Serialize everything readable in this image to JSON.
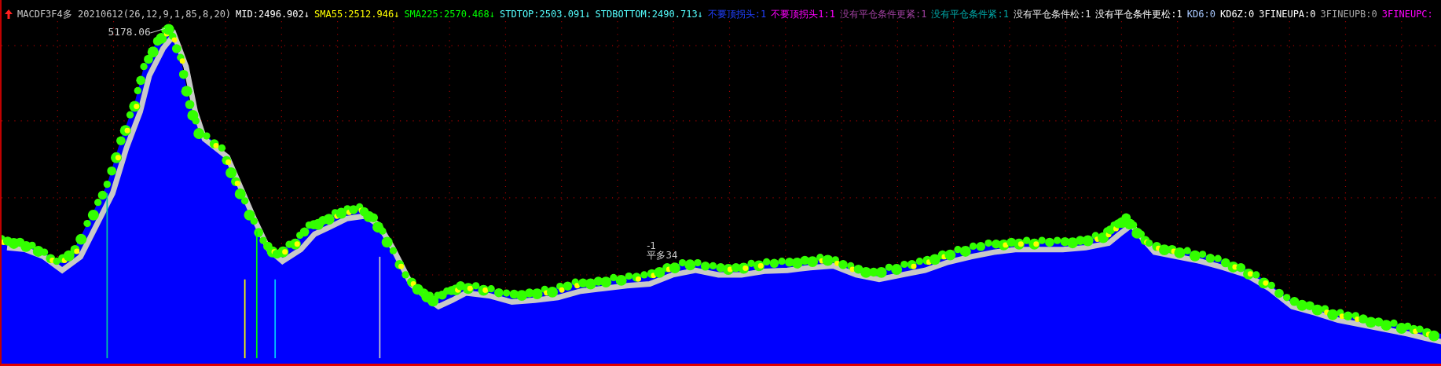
{
  "indicator_bar": {
    "items": [
      {
        "text": "MACDF3F4多 20210612(26,12,9,1,85,8,20)",
        "color": "#c8c8c8"
      },
      {
        "text": "MID:2496.902↓",
        "color": "#ffffff"
      },
      {
        "text": "SMA55:2512.946↓",
        "color": "#ffff00"
      },
      {
        "text": "SMA225:2570.468↓",
        "color": "#00ff00"
      },
      {
        "text": "STDTOP:2503.091↓",
        "color": "#54fcfc"
      },
      {
        "text": "STDBOTTOM:2490.713↓",
        "color": "#54fcfc"
      },
      {
        "text": "不要顶拐头:1",
        "color": "#2040ff"
      },
      {
        "text": "不要顶拐头1:1",
        "color": "#ff00ff"
      },
      {
        "text": "没有平仓条件更紧:1",
        "color": "#a040a0"
      },
      {
        "text": "没有平仓条件紧:1",
        "color": "#00a8a8"
      },
      {
        "text": "没有平仓条件松:1",
        "color": "#e8e8e8"
      },
      {
        "text": "没有平仓条件更松:1",
        "color": "#ffffff"
      },
      {
        "text": "KD6:0",
        "color": "#a8c8ff"
      },
      {
        "text": "KD6Z:0",
        "color": "#ffffff"
      },
      {
        "text": "3FINEUPA:0",
        "color": "#ffffff"
      },
      {
        "text": "3FINEUPB:0",
        "color": "#a8a8a8"
      },
      {
        "text": "3FINEUPC:",
        "color": "#ff00ff"
      }
    ]
  },
  "chart": {
    "peak_label": "5178.06",
    "signal_labels": [
      "-1",
      "平多34"
    ]
  }
}
